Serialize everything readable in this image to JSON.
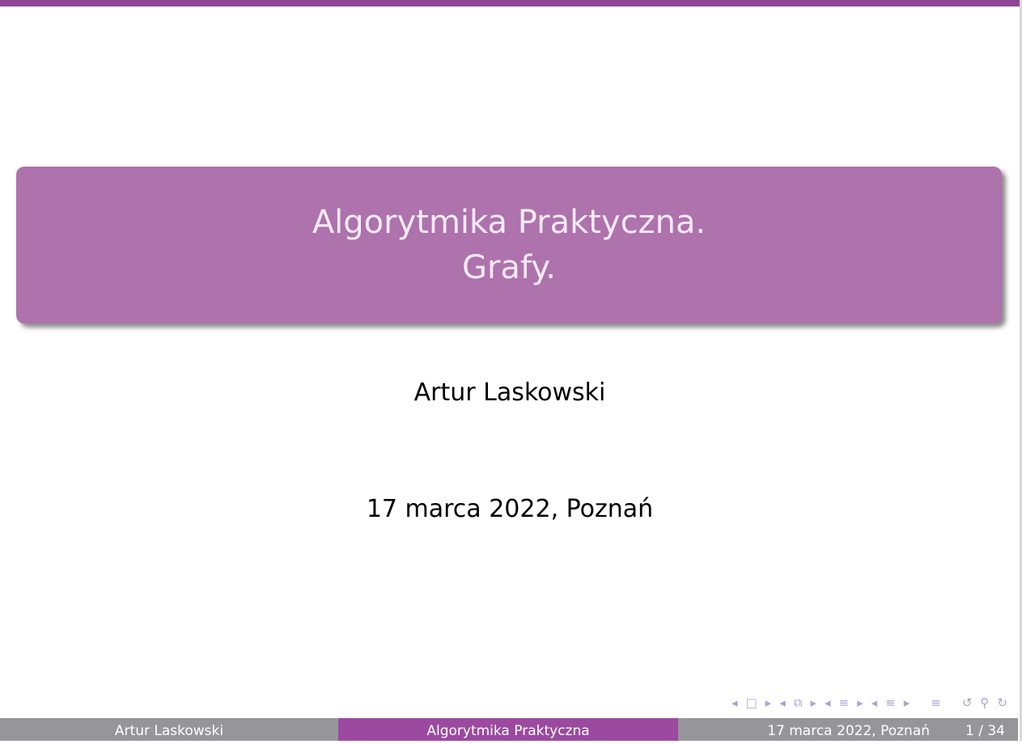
{
  "title": {
    "line1": "Algorytmika Praktyczna.",
    "line2": "Grafy."
  },
  "author": "Artur Laskowski",
  "date": "17 marca 2022, Poznań",
  "footer": {
    "author": "Artur Laskowski",
    "title": "Algorytmika Praktyczna",
    "date": "17 marca 2022, Poznań",
    "page": "1 / 34"
  },
  "nav": {
    "icons": [
      "◂",
      "□",
      "▸",
      "◂",
      "⧉",
      "▸",
      "◂",
      "≡",
      "▸",
      "◂",
      "≡",
      "▸",
      "≡",
      "↺",
      "⚲",
      "↻"
    ]
  },
  "colors": {
    "accent": "#8f4593",
    "title_box": "#ae72ad",
    "footer_gray": "#96969a"
  }
}
